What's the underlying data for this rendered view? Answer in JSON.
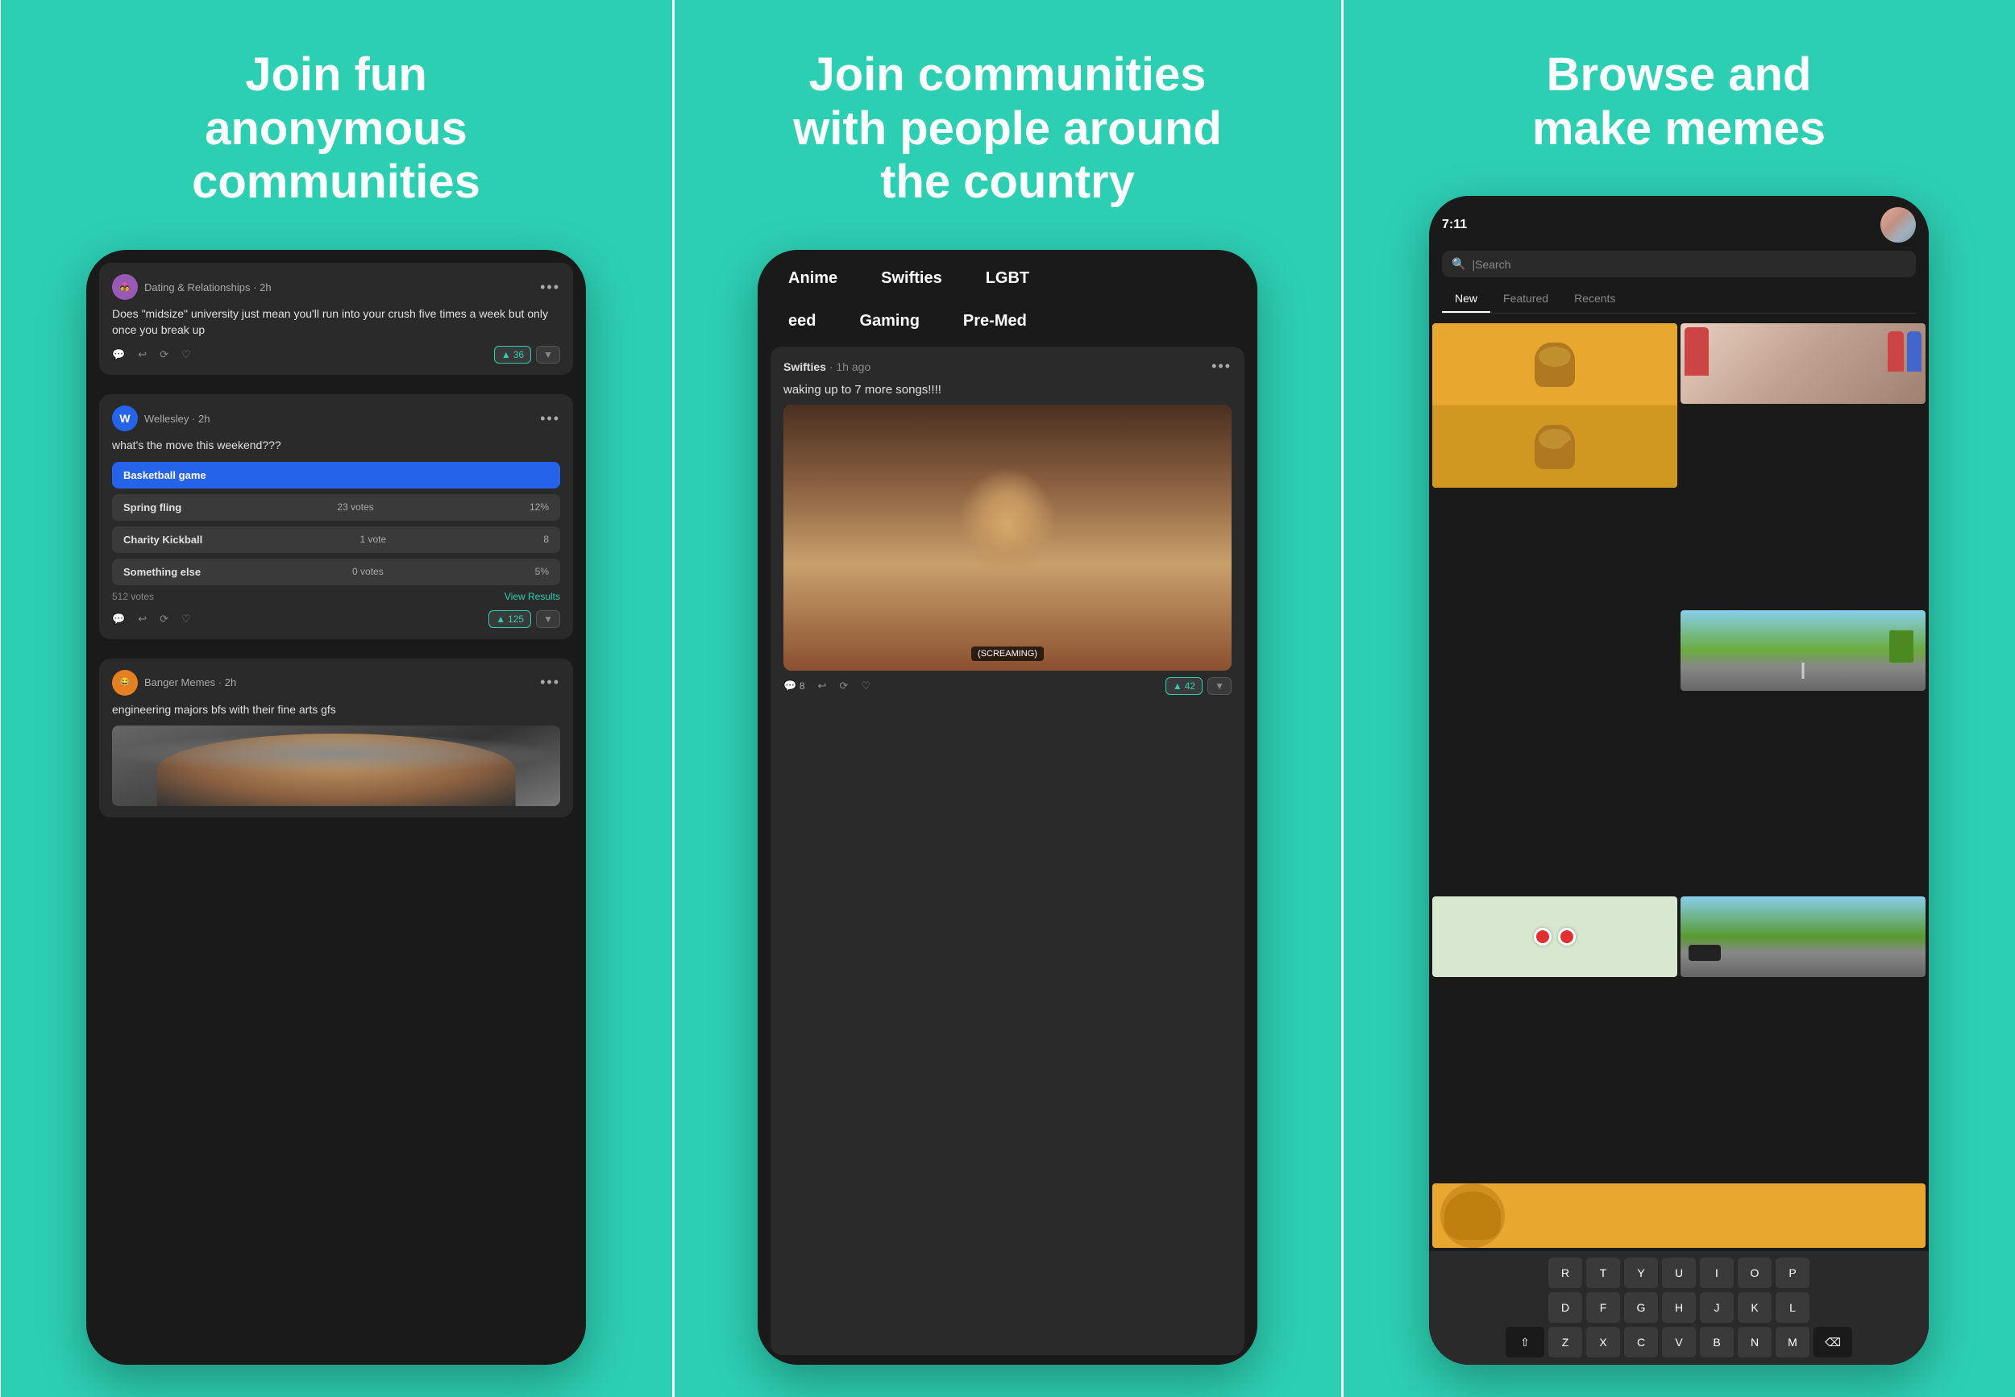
{
  "panel1": {
    "title": "Join fun\nanonymous\ncommunities",
    "card1": {
      "community": "Dating & Relationships",
      "time": "2h",
      "text": "Does \"midsize\" university just mean you'll run into your crush five times a week but only once you break up",
      "votes": "36"
    },
    "card2": {
      "community": "Wellesley",
      "time": "2h",
      "text": "what's the move this weekend???",
      "options": [
        {
          "label": "Basketball game",
          "votes": "",
          "pct": "",
          "selected": true
        },
        {
          "label": "Spring fling",
          "votes": "23 votes",
          "pct": "12%",
          "selected": false
        },
        {
          "label": "Charity Kickball",
          "votes": "1 vote",
          "pct": "8",
          "selected": false
        },
        {
          "label": "Something else",
          "votes": "0 votes",
          "pct": "5%",
          "selected": false
        }
      ],
      "totalVotes": "512 votes",
      "viewResults": "View Results",
      "votes": "125"
    },
    "card3": {
      "community": "Banger Memes",
      "time": "2h",
      "text": "engineering majors bfs with their fine arts gfs"
    }
  },
  "panel2": {
    "title": "Join communities\nwith people around\nthe country",
    "tags": [
      "Anime",
      "Swifties",
      "LGBT",
      "eed",
      "Gaming",
      "Pre-Med"
    ],
    "post": {
      "community": "Swifties",
      "time": "1h ago",
      "text": "waking up to 7 more songs!!!!",
      "screaming": "(SCREAMING)",
      "votes": "42"
    }
  },
  "panel3": {
    "title": "Browse and\nmake memes",
    "time": "7:11",
    "searchPlaceholder": "Search",
    "tabs": [
      "New",
      "Featured",
      "Recents"
    ],
    "activeTab": "New",
    "keyboard": {
      "row1": [
        "R",
        "T",
        "Y",
        "U",
        "I",
        "O",
        "P"
      ],
      "row2": [
        "D",
        "F",
        "G",
        "H",
        "J",
        "K",
        "L"
      ],
      "row3": [
        "Z",
        "X",
        "C",
        "V",
        "B",
        "N",
        "M"
      ]
    }
  },
  "icons": {
    "comment": "💬",
    "share": "↩",
    "repost": "🔄",
    "like": "♡",
    "upvote": "▲",
    "dots": "•••",
    "search": "🔍",
    "backspace": "⌫",
    "shift": "⇧"
  }
}
